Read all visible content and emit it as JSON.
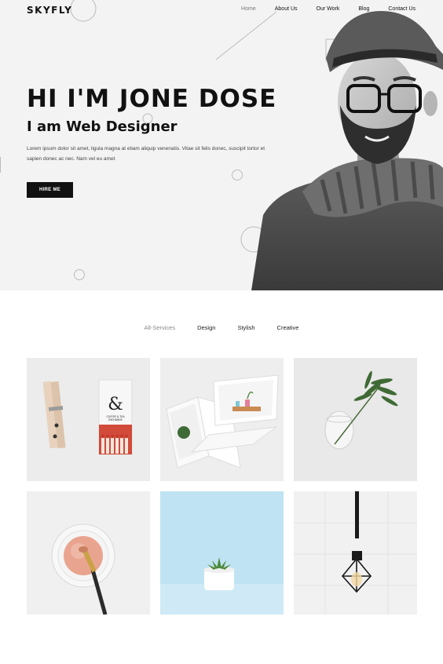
{
  "header": {
    "logo": "SKYFLY",
    "nav": [
      {
        "label": "Home",
        "active": true
      },
      {
        "label": "About Us",
        "active": false
      },
      {
        "label": "Our Work",
        "active": false
      },
      {
        "label": "Blog",
        "active": false
      },
      {
        "label": "Contact Us",
        "active": false
      }
    ]
  },
  "hero": {
    "title": "HI I'M JONE DOSE",
    "subtitle": "I am Web Designer",
    "text": "Lorem ipsum dolor sit amet, ligula magna at etiam aliquip venenatis. Vitae sit felis donec, suscipit tortor et sapien donec ac nec. Nam vel eu amet",
    "button_label": "HIRE ME"
  },
  "portfolio": {
    "filters": [
      {
        "label": "All-Services",
        "active": true
      },
      {
        "label": "Design",
        "active": false
      },
      {
        "label": "Stylish",
        "active": false
      },
      {
        "label": "Creative",
        "active": false
      }
    ],
    "matchbox_text": "COFFEE & TEA\nEXCHANGE",
    "tiles": [
      {
        "name": "clothespin-matchbox-image"
      },
      {
        "name": "laptops-image"
      },
      {
        "name": "plant-in-glass-image"
      },
      {
        "name": "makeup-brush-image"
      },
      {
        "name": "succulent-pot-image"
      },
      {
        "name": "pendant-lamp-image"
      }
    ]
  },
  "colors": {
    "hero_bg": "#f3f3f3",
    "button_bg": "#111111",
    "text": "#111111",
    "muted": "#888888"
  }
}
